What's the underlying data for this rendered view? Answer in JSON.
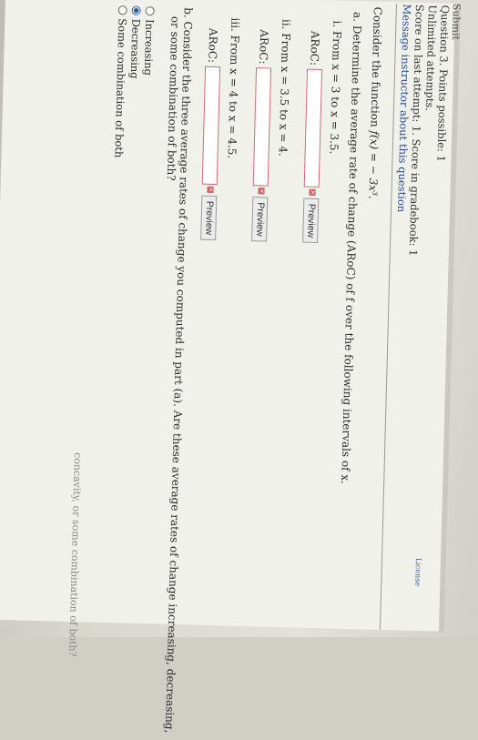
{
  "header": {
    "tab_label": "Submit",
    "question_points": "Question 3. Points possible: 1",
    "attempts": "Unlimited attempts.",
    "score": "Score on last attempt: 1. Score in gradebook: 1",
    "message_link": "Message instructor about this question",
    "license": "License"
  },
  "question": {
    "intro": "Consider the function",
    "function_text": "f(x) = − 3x³.",
    "part_a": "a. Determine the average rate of change (ARoC) of f over the following intervals of x.",
    "intervals": [
      {
        "label": "i. From x = 3 to x = 3.5.",
        "aroc_label": "ARoC:",
        "preview": "Preview"
      },
      {
        "label": "ii. From x = 3.5 to x = 4.",
        "aroc_label": "ARoC:",
        "preview": "Preview"
      },
      {
        "label": "iii. From x = 4 to x = 4.5.",
        "aroc_label": "ARoC:",
        "preview": "Preview"
      }
    ],
    "part_b": "b. Consider the three average rates of change you computed in part (a). Are these average rates of change increasing, decreasing,",
    "part_b_cont": "or some combination of both?",
    "options": [
      {
        "label": "Increasing",
        "selected": false
      },
      {
        "label": "Decreasing",
        "selected": true
      },
      {
        "label": "Some combination of both",
        "selected": false
      }
    ],
    "faint_bottom": "concavity, or some combination of both?"
  },
  "colors": {
    "input_border": "#d26b73",
    "link": "#2a4b9a",
    "selected_radio": "#2f5fb5"
  }
}
